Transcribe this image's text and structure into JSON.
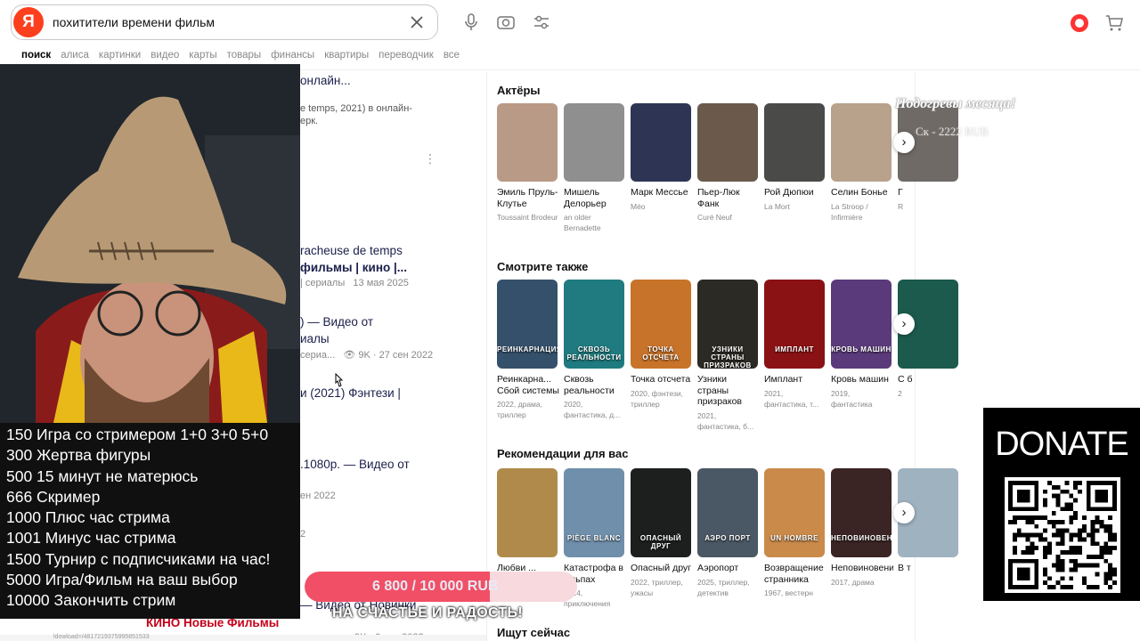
{
  "search": {
    "logo": "Я",
    "query": "похитители времени фильм"
  },
  "tabs": [
    "поиск",
    "алиса",
    "картинки",
    "видео",
    "карты",
    "товары",
    "финансы",
    "квартиры",
    "переводчик",
    "все"
  ],
  "results": [
    {
      "text": "онлайн..."
    },
    {
      "text": "e temps, 2021) в онлайн-"
    },
    {
      "text": "ерк."
    },
    {
      "text": "racheuse de temps"
    },
    {
      "text": "фильмы | кино |..."
    },
    {
      "text": "| сериалы",
      "date": "13 мая 2025"
    },
    {
      "text": ") — Видео от"
    },
    {
      "text": "иалы"
    },
    {
      "text": "сериа...",
      "views": "9K · 27 сен 2022"
    },
    {
      "text": "и (2021) Фэнтези |"
    },
    {
      "text": ".1080p. — Видео от"
    },
    {
      "text": "ен 2022"
    },
    {
      "text": "2"
    },
    {
      "text": "— Видео от Новинки"
    },
    {
      "text": "КИНО Новые Фильмы"
    },
    {
      "text": "9K · 9 сен 2022"
    }
  ],
  "panel": {
    "actors_title": "Актёры",
    "actors": [
      {
        "name": "Эмиль Пруль-Клутье",
        "role": "Toussaint Brodeur"
      },
      {
        "name": "Мишель Делорьер",
        "role": "an older Bernadette"
      },
      {
        "name": "Марк Мессье",
        "role": "Méo"
      },
      {
        "name": "Пьер-Люк Фанк",
        "role": "Curé Neuf"
      },
      {
        "name": "Рой Дюпюи",
        "role": "La Mort"
      },
      {
        "name": "Селин Бонье",
        "role": "La Stroop / Infirmière"
      },
      {
        "name": "Г",
        "role": "R"
      }
    ],
    "also_title": "Смотрите также",
    "also": [
      {
        "name": "Реинкарна... Сбой системы",
        "meta": "2022, драма, триллер",
        "poster": "РЕИНКАРНАЦИЯ"
      },
      {
        "name": "Сквозь реальности",
        "meta": "2020, фантастика, д...",
        "poster": "СКВОЗЬ РЕАЛЬНОСТИ"
      },
      {
        "name": "Точка отсчета",
        "meta": "2020, фэнтези, триллер",
        "poster": "ТОЧКА ОТСЧЕТА"
      },
      {
        "name": "Узники страны призраков",
        "meta": "2021, фантастика, б...",
        "poster": "УЗНИКИ СТРАНЫ ПРИЗРАКОВ"
      },
      {
        "name": "Имплант",
        "meta": "2021, фантастика, т...",
        "poster": "ИМПЛАНТ"
      },
      {
        "name": "Кровь машин",
        "meta": "2019, фантастика",
        "poster": "КРОВЬ МАШИН"
      },
      {
        "name": "С б",
        "meta": "2"
      }
    ],
    "rec_title": "Рекомендации для вас",
    "rec": [
      {
        "name": "Любви ...",
        "meta": "",
        "poster": ""
      },
      {
        "name": "Катастрофа в Альпах",
        "meta": "2014, приключения",
        "poster": "PIÈGE BLANC"
      },
      {
        "name": "Опасный друг",
        "meta": "2022, триллер, ужасы",
        "poster": "ОПАСНЫЙ ДРУГ"
      },
      {
        "name": "Аэропорт",
        "meta": "2025, триллер, детектив",
        "poster": "АЭРО ПОРТ"
      },
      {
        "name": "Возвращение странника",
        "meta": "1967, вестерн",
        "poster": "UN HOMBRE"
      },
      {
        "name": "Неповиновение",
        "meta": "2017, драма",
        "poster": "НЕПОВИНОВЕНИЕ"
      },
      {
        "name": "В т",
        "meta": ""
      }
    ],
    "now_title": "Ищут сейчас"
  },
  "stream": {
    "goals": [
      "150 Игра со стримером 1+0 3+0 5+0",
      "300 Жертва фигуры",
      "500 15 минут не матерюсь",
      "666 Скример",
      "1000 Плюс час стрима",
      "1001 Минус час стрима",
      "1500 Турнир с подписчиками на час!",
      "5000 Игра/Фильм на ваш выбор",
      "10000 Закончить стрим"
    ],
    "donate_label": "DONATE",
    "progress_text": "6 800 / 10 000 RUB",
    "progress_value": 0.68,
    "caption": "НА СЧАСТЬЕ И РАДОСТЬ!",
    "gift_title": "Подогревы месяца!",
    "gift_sub": "Ск - 2222 RUB",
    "footer_url": "ldowload=/4817219375995851533"
  }
}
